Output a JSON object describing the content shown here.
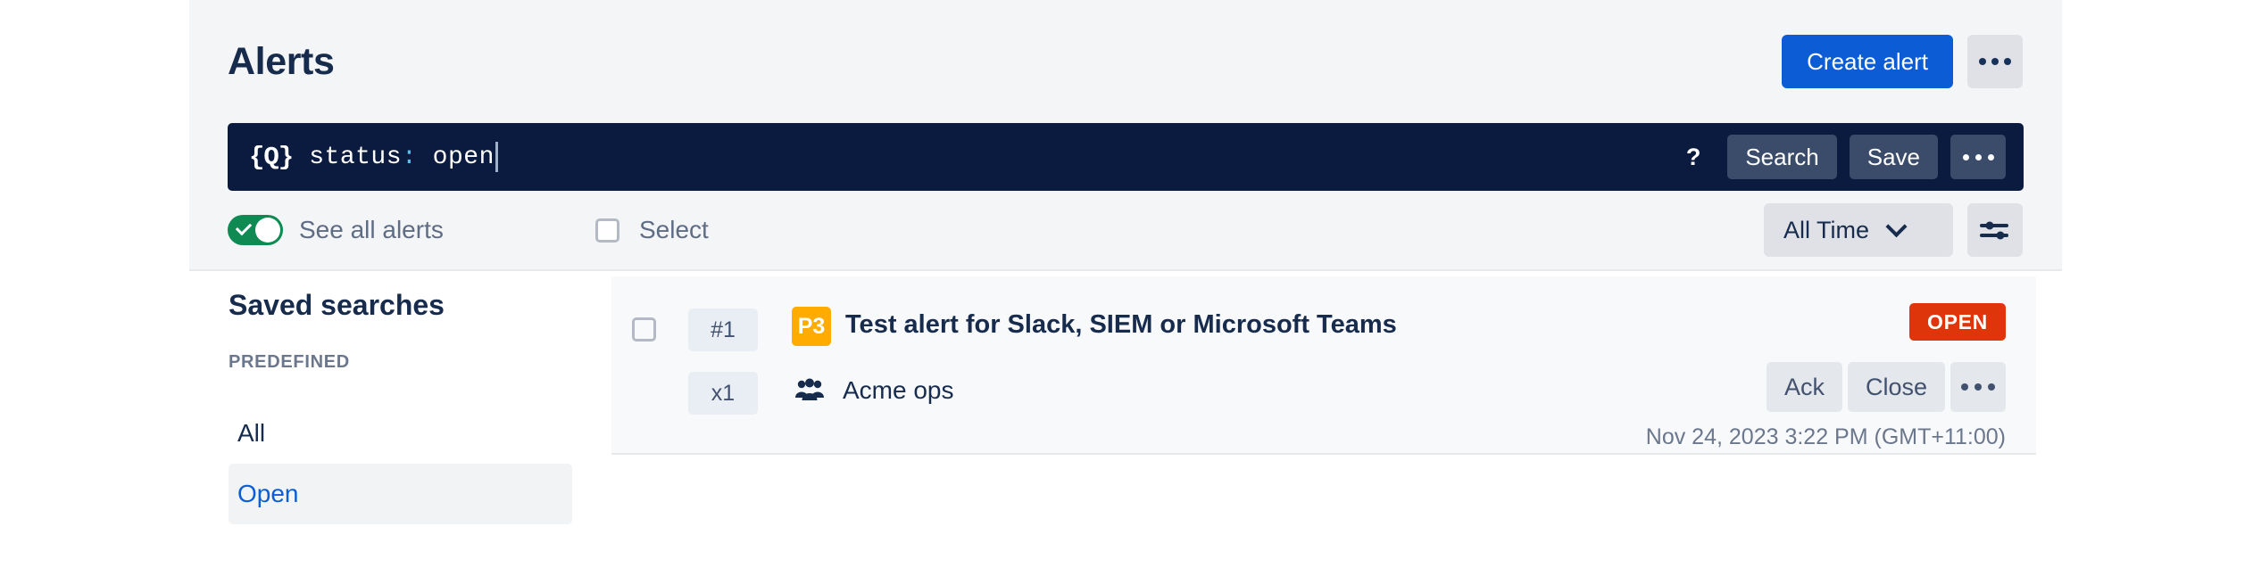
{
  "header": {
    "title": "Alerts",
    "create_button": "Create alert",
    "more_icon": "ellipsis-icon"
  },
  "search": {
    "query_icon": "{Q}",
    "query_prefix": "status",
    "query_punct": ":",
    "query_value": " open",
    "help": "?",
    "search_button": "Search",
    "save_button": "Save",
    "more_icon": "ellipsis-icon"
  },
  "toolbar": {
    "toggle_label": "See all alerts",
    "toggle_on": true,
    "select_label": "Select",
    "select_checked": false,
    "time_filter": "All Time",
    "filter_icon": "sliders-icon",
    "chevron_icon": "chevron-down-icon"
  },
  "sidebar": {
    "title": "Saved searches",
    "section_label": "PREDEFINED",
    "items": [
      {
        "label": "All",
        "active": false
      },
      {
        "label": "Open",
        "active": true
      }
    ]
  },
  "alerts": [
    {
      "id_badge": "#1",
      "repeat_badge": "x1",
      "priority": "P3",
      "title": "Test alert for Slack, SIEM or Microsoft Teams",
      "team": "Acme ops",
      "team_icon": "people-group-icon",
      "status": "OPEN",
      "actions": {
        "ack": "Ack",
        "close": "Close",
        "more_icon": "ellipsis-icon"
      },
      "timestamp": "Nov 24, 2023 3:22 PM (GMT+11:00)"
    }
  ],
  "colors": {
    "primary_blue": "#0B5CD5",
    "search_bg": "#0B1B3F",
    "toggle_green": "#0E8A52",
    "priority_amber": "#FFAB00",
    "status_red": "#DE350B",
    "link_blue": "#0C5ED4",
    "text_navy": "#172B4D",
    "panel_gray": "#F4F5F7"
  }
}
